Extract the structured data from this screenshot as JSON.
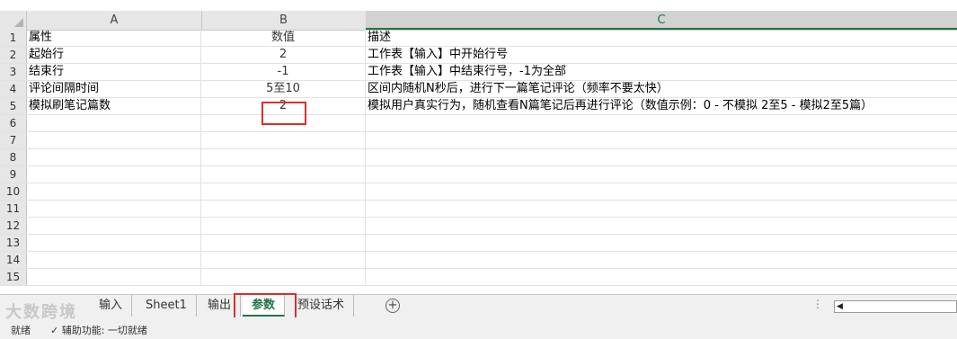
{
  "columns": [
    {
      "letter": "A"
    },
    {
      "letter": "B"
    },
    {
      "letter": "C"
    }
  ],
  "rows": [
    {
      "num": "1",
      "a": "属性",
      "b": "数值",
      "c": "描述"
    },
    {
      "num": "2",
      "a": "起始行",
      "b": "2",
      "c": "工作表【输入】中开始行号"
    },
    {
      "num": "3",
      "a": "结束行",
      "b": "-1",
      "c": "工作表【输入】中结束行号，-1为全部"
    },
    {
      "num": "4",
      "a": "评论间隔时间",
      "b": "5至10",
      "c": "区间内随机N秒后，进行下一篇笔记评论（频率不要太快）"
    },
    {
      "num": "5",
      "a": "模拟刷笔记篇数",
      "b": "2",
      "c": "模拟用户真实行为，随机查看N篇笔记后再进行评论（数值示例：0 - 不模拟  2至5 - 模拟2至5篇）"
    },
    {
      "num": "6",
      "a": "",
      "b": "",
      "c": ""
    },
    {
      "num": "7",
      "a": "",
      "b": "",
      "c": ""
    },
    {
      "num": "8",
      "a": "",
      "b": "",
      "c": ""
    },
    {
      "num": "9",
      "a": "",
      "b": "",
      "c": ""
    },
    {
      "num": "10",
      "a": "",
      "b": "",
      "c": ""
    },
    {
      "num": "11",
      "a": "",
      "b": "",
      "c": ""
    },
    {
      "num": "12",
      "a": "",
      "b": "",
      "c": ""
    },
    {
      "num": "13",
      "a": "",
      "b": "",
      "c": ""
    },
    {
      "num": "14",
      "a": "",
      "b": "",
      "c": ""
    },
    {
      "num": "15",
      "a": "",
      "b": "",
      "c": ""
    }
  ],
  "tabs": [
    "输入",
    "Sheet1",
    "输出",
    "参数",
    "预设话术"
  ],
  "active_tab": "参数",
  "add_sheet": "+",
  "scroll_dots": "⋮",
  "status": {
    "ready": "就绪",
    "accessibility": "辅助功能: 一切就绪"
  },
  "watermark": "大数跨境",
  "colors": {
    "accent": "#217346",
    "highlight": "#d9302e"
  },
  "icons": [
    "add-sheet-icon",
    "scroll-left-icon",
    "accessibility-icon",
    "select-all-icon"
  ]
}
